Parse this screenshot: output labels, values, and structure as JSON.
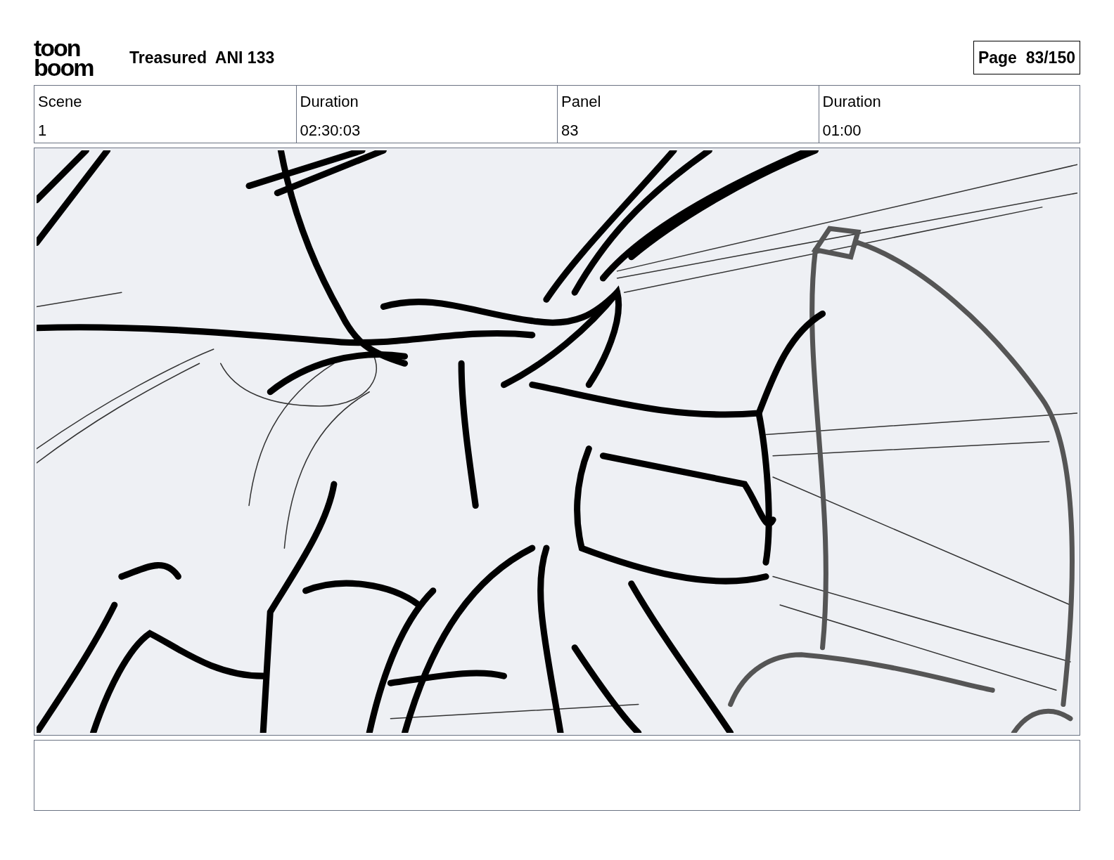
{
  "logo": {
    "lines": [
      "toon",
      "boom"
    ]
  },
  "title": "Treasured  ANI 133",
  "page": "Page  83/150",
  "info": [
    {
      "label": "Scene",
      "value": "1"
    },
    {
      "label": "Duration",
      "value": "02:30:03"
    },
    {
      "label": "Panel",
      "value": "83"
    },
    {
      "label": "Duration",
      "value": "01:00"
    }
  ]
}
